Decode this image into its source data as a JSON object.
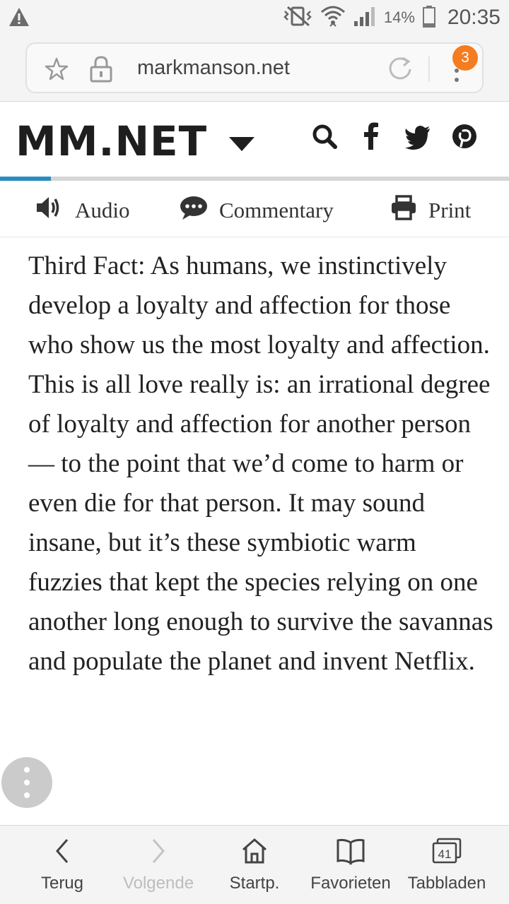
{
  "status_bar": {
    "battery_percent": "14%",
    "time": "20:35"
  },
  "browser": {
    "url": "markmanson.net",
    "tabs_badge": "3"
  },
  "site": {
    "logo": "MM.NET",
    "reading_progress": 0.1
  },
  "toolbar": {
    "audio_label": "Audio",
    "commentary_label": "Commentary",
    "print_label": "Print"
  },
  "article": {
    "paragraph": "Third Fact: As humans, we instinctively develop a loyalty and affection for those who show us the most loyalty and affection. This is all love really is: an irrational degree of loyalty and affection for another person — to the point that we’d come to harm or even die for that person. It may sound insane, but it’s these symbiotic warm fuzzies that kept the species relying on one another long enough to survive the savannas and populate the planet and invent Netflix."
  },
  "bottom_nav": {
    "back_label": "Terug",
    "forward_label": "Volgende",
    "home_label": "Startp.",
    "bookmarks_label": "Favorieten",
    "tabs_label": "Tabbladen",
    "tabs_count": "41"
  },
  "colors": {
    "accent_progress": "#2b8cbf",
    "badge": "#f57c1f"
  }
}
